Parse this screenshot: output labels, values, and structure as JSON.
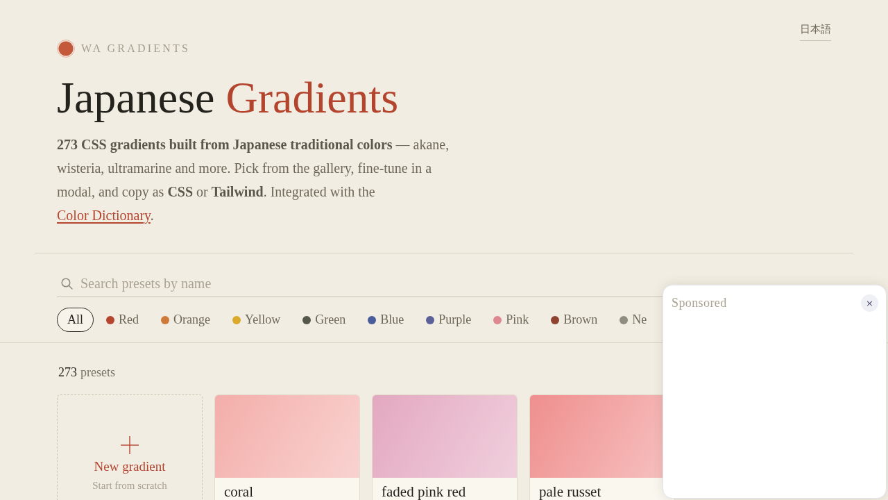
{
  "header": {
    "brand": "WA GRADIENTS",
    "language_link": "日本語"
  },
  "hero": {
    "title": "Japanese",
    "title_accent": "Gradients",
    "description": "**273 CSS gradients built from Japanese traditional colors** — akane, wisteria, ultramarine and more. Pick from the gallery, fine-tune in a modal, and copy as **CSS** or **Tailwind**. Integrated with the",
    "description_link": "Color Dictionary",
    "description_end": "."
  },
  "search": {
    "placeholder": "Search presets by name"
  },
  "filters": [
    {
      "label": "All",
      "selected": true
    },
    {
      "label": "Red",
      "selected": false,
      "color": "#b5452f"
    },
    {
      "label": "Orange",
      "selected": false,
      "color": "#cf7a3a"
    },
    {
      "label": "Yellow",
      "selected": false,
      "color": "#dcaa2a"
    },
    {
      "label": "Green",
      "selected": false,
      "color": "#55574a"
    },
    {
      "label": "Blue",
      "selected": false,
      "color": "#4b5c9a"
    },
    {
      "label": "Purple",
      "selected": false,
      "color": "#5b6098"
    },
    {
      "label": "Pink",
      "selected": false,
      "color": "#dd8890"
    },
    {
      "label": "Brown",
      "selected": false,
      "color": "#8e4430"
    },
    {
      "label": "Ne",
      "selected": false,
      "color": "#8f8e80"
    }
  ],
  "results": {
    "count": "273",
    "count_label": "presets"
  },
  "new_card": {
    "title": "New gradient",
    "subtitle": "Start from scratch"
  },
  "presets": [
    {
      "name": "coral",
      "color": "#f3aeaa"
    },
    {
      "name": "faded pink red",
      "color": "#e3a8c0"
    },
    {
      "name": "pale russet",
      "color": "#ee8f8e"
    }
  ],
  "ad": {
    "label": "Sponsored",
    "close": "×"
  }
}
